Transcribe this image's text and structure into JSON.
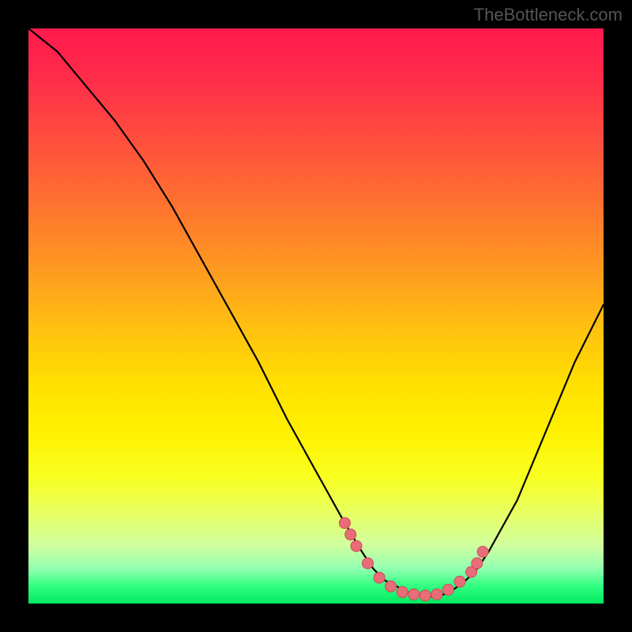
{
  "watermark": "TheBottleneck.com",
  "chart_data": {
    "type": "line",
    "title": "",
    "xlabel": "",
    "ylabel": "",
    "xlim": [
      0,
      100
    ],
    "ylim": [
      0,
      100
    ],
    "grid": false,
    "legend": false,
    "series": [
      {
        "name": "curve",
        "x": [
          0,
          5,
          10,
          15,
          20,
          25,
          30,
          35,
          40,
          45,
          50,
          55,
          58,
          60,
          62,
          64,
          66,
          68,
          70,
          72,
          74,
          76,
          78,
          80,
          85,
          90,
          95,
          100
        ],
        "y": [
          100,
          96,
          90,
          84,
          77,
          69,
          60,
          51,
          42,
          32,
          23,
          14,
          9,
          6,
          4,
          3,
          2,
          1.5,
          1.2,
          1.5,
          2.5,
          4,
          6,
          9,
          18,
          30,
          42,
          52
        ]
      }
    ],
    "markers": {
      "name": "dots",
      "x": [
        55,
        56,
        57,
        59,
        61,
        63,
        65,
        67,
        69,
        71,
        73,
        75,
        77,
        78,
        79
      ],
      "y": [
        14,
        12,
        10,
        7,
        4.5,
        3,
        2,
        1.6,
        1.4,
        1.6,
        2.4,
        3.8,
        5.5,
        7,
        9
      ]
    },
    "gradient_colors": {
      "top": "#ff1a4d",
      "middle": "#ffe000",
      "bottom": "#00e860"
    }
  }
}
